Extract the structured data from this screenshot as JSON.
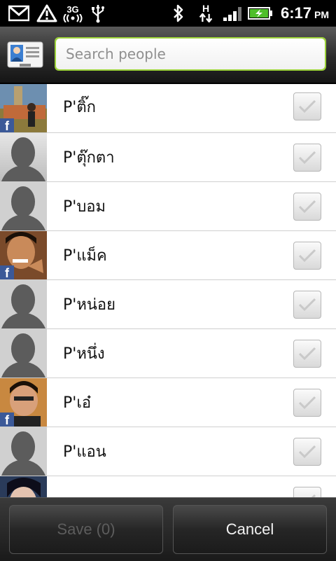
{
  "statusbar": {
    "network": "3G",
    "data_type": "H",
    "time": "6:17",
    "ampm": "PM",
    "icons": [
      "gmail-icon",
      "warning-icon",
      "3g-signal-icon",
      "usb-icon",
      "bluetooth-icon",
      "h-data-icon",
      "signal-bars-icon",
      "battery-charging-icon"
    ]
  },
  "search": {
    "placeholder": "Search people"
  },
  "contacts": [
    {
      "name": "P'ติ๊ก",
      "facebook": true,
      "photo": "photo"
    },
    {
      "name": "P'ตุ๊กตา",
      "facebook": false,
      "photo": "silhouette"
    },
    {
      "name": "P'บอม",
      "facebook": false,
      "photo": "silhouette"
    },
    {
      "name": "P'แม็ค",
      "facebook": true,
      "photo": "photo"
    },
    {
      "name": "P'หน่อย",
      "facebook": false,
      "photo": "silhouette"
    },
    {
      "name": "P'หนึ่ง",
      "facebook": false,
      "photo": "silhouette"
    },
    {
      "name": "P'เอ๋",
      "facebook": true,
      "photo": "photo"
    },
    {
      "name": "P'แอน",
      "facebook": false,
      "photo": "silhouette"
    },
    {
      "name": "",
      "facebook": false,
      "photo": "photo"
    }
  ],
  "buttons": {
    "save": "Save (0)",
    "cancel": "Cancel"
  },
  "colors": {
    "search_focus_border": "#9cd23a",
    "facebook_badge": "#3b5998",
    "save_disabled_text": "#5d5d5d"
  }
}
